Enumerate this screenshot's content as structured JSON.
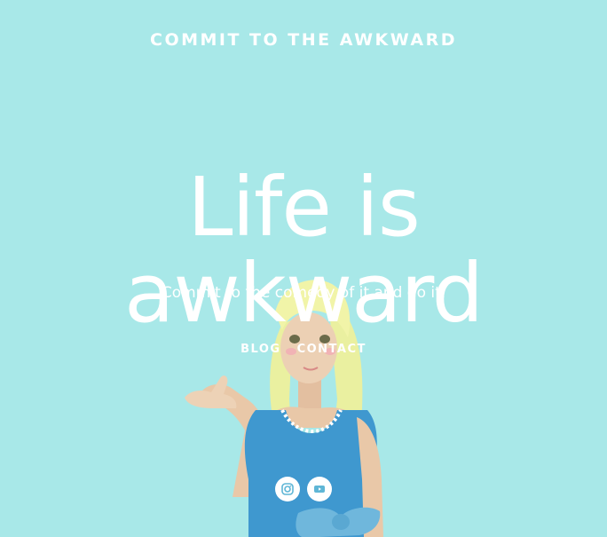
{
  "site": {
    "title": "COMMIT TO THE AWKWARD"
  },
  "hero": {
    "title": "Life is awkward",
    "tagline": "Commit to the comedy of it and do it."
  },
  "nav": {
    "items": [
      {
        "label": "BLOG"
      },
      {
        "label": "CONTACT"
      }
    ]
  },
  "social": {
    "icons": [
      "instagram-icon",
      "youtube-icon"
    ]
  },
  "colors": {
    "background": "#a8e8e8",
    "text": "#ffffff",
    "dress": "#3f98cf",
    "hair": "#eaf0a0",
    "skin": "#e9c8a8"
  }
}
